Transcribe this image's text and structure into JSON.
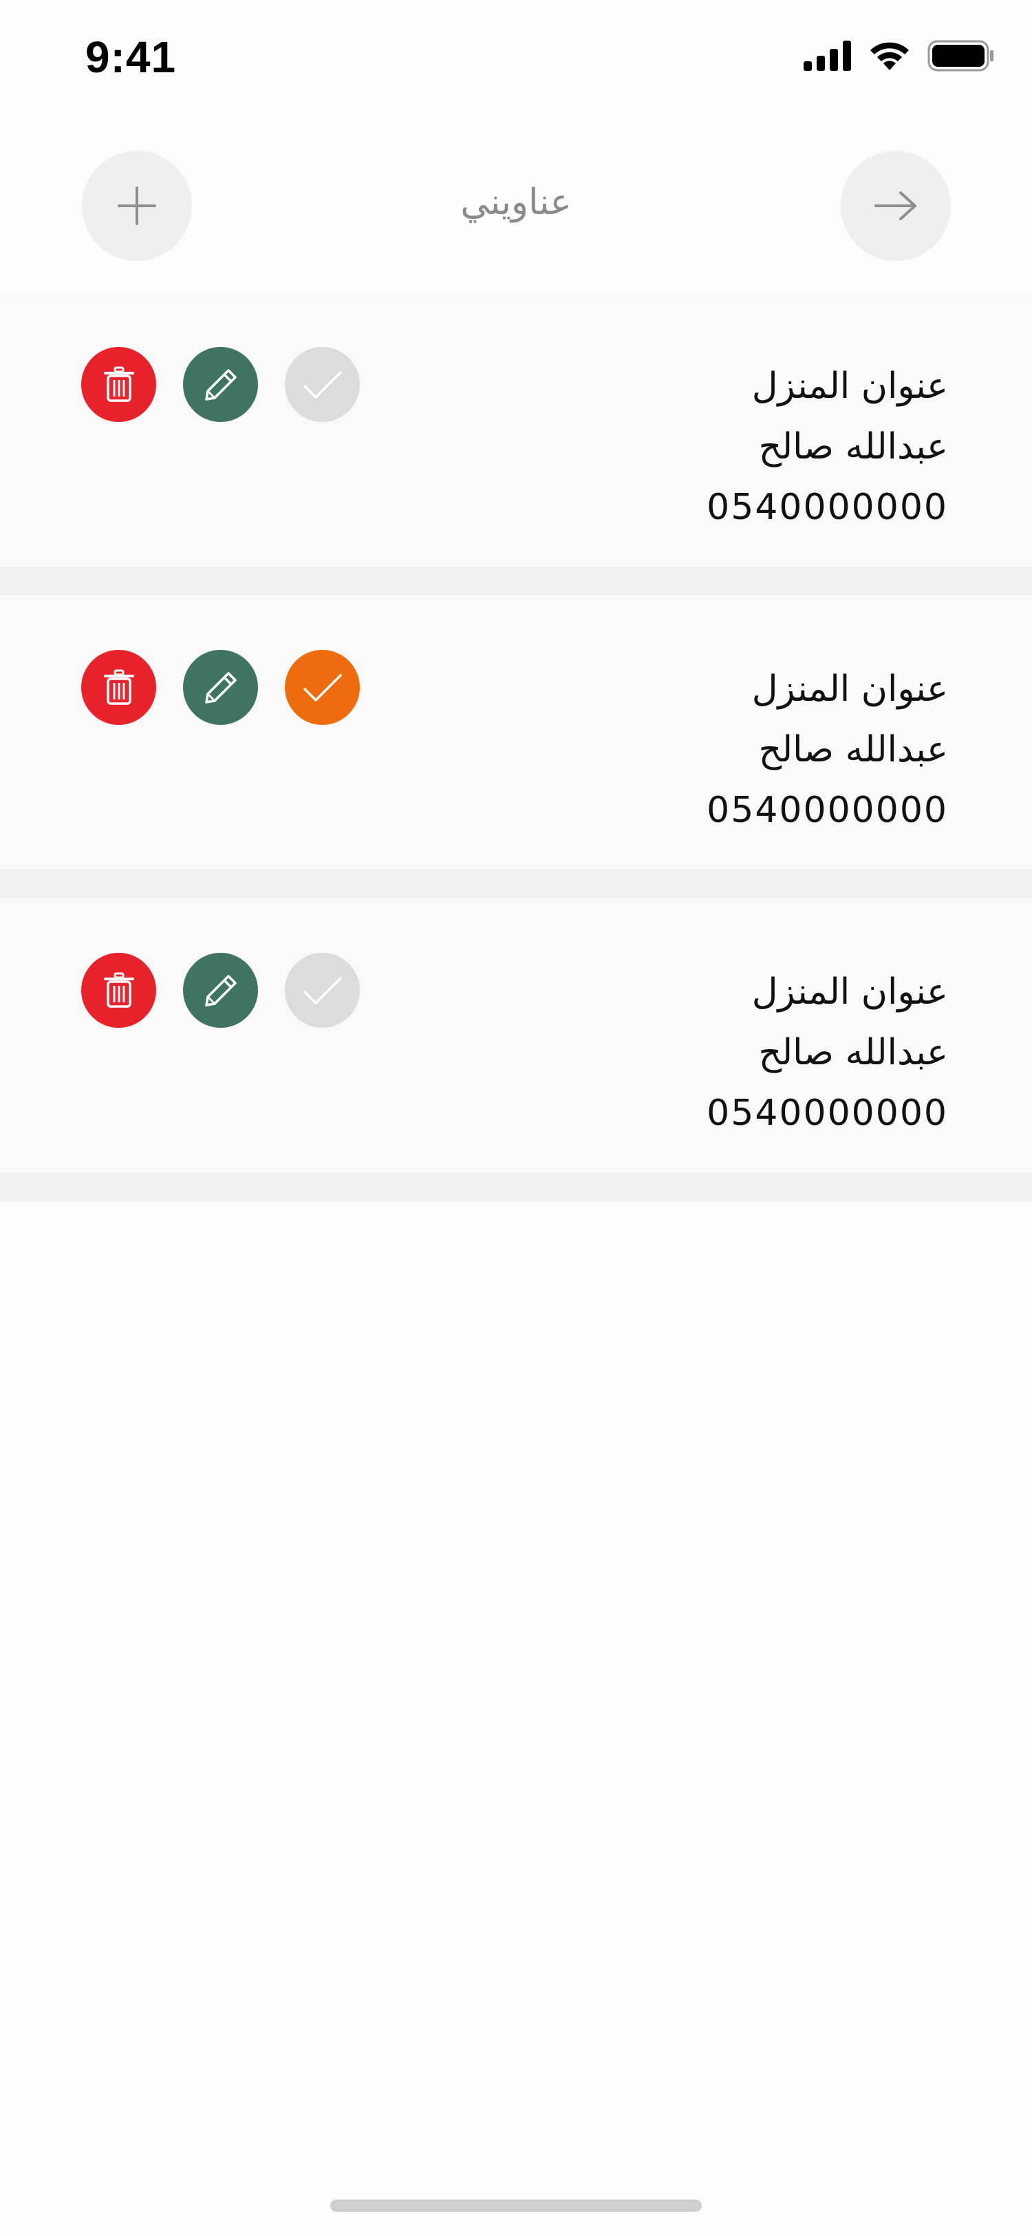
{
  "status_bar": {
    "time": "9:41"
  },
  "header": {
    "title": "عناويني",
    "add_icon": "plus-icon",
    "back_icon": "arrow-right-icon"
  },
  "addresses": [
    {
      "label": "عنوان المنزل",
      "name": "عبدالله صالح",
      "phone": "0540000000",
      "is_default": false
    },
    {
      "label": "عنوان المنزل",
      "name": "عبدالله صالح",
      "phone": "0540000000",
      "is_default": true
    },
    {
      "label": "عنوان المنزل",
      "name": "عبدالله صالح",
      "phone": "0540000000",
      "is_default": false
    }
  ],
  "colors": {
    "delete": "#e8222b",
    "edit": "#3f7462",
    "default_selected": "#ee6c0e",
    "default_unselected": "#dcdcdc",
    "header_button": "#efefef"
  },
  "icons": {
    "delete": "trash-icon",
    "edit": "pencil-icon",
    "default": "check-icon"
  }
}
